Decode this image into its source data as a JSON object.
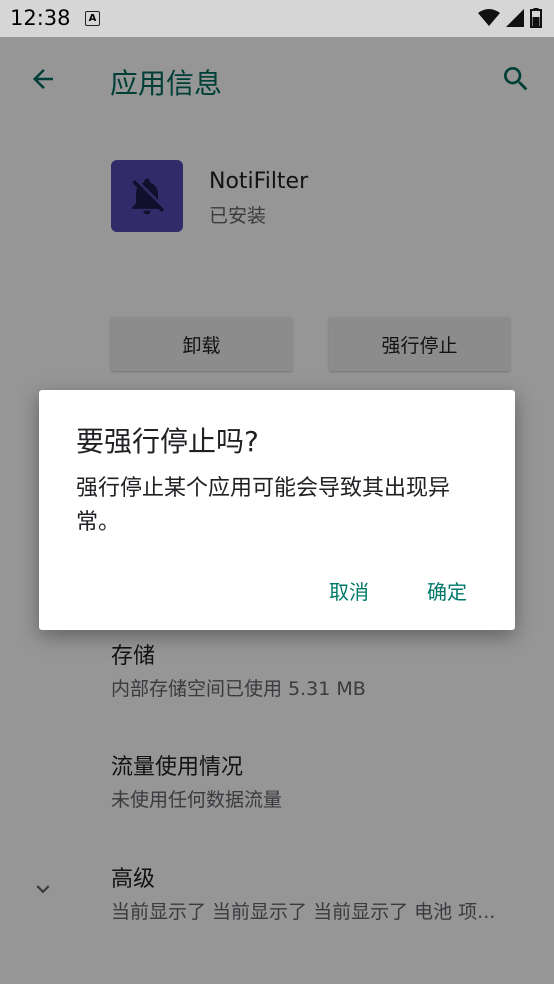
{
  "status_bar": {
    "time": "12:38",
    "notification_icon": "A"
  },
  "app_bar": {
    "title": "应用信息"
  },
  "app": {
    "name": "NotiFilter",
    "status": "已安装"
  },
  "actions": {
    "uninstall": "卸载",
    "force_stop": "强行停止"
  },
  "prefs": {
    "storage": {
      "title": "存储",
      "summary": "内部存储空间已使用 5.31 MB"
    },
    "data_usage": {
      "title": "流量使用情况",
      "summary": "未使用任何数据流量"
    },
    "advanced": {
      "title": "高级",
      "summary": "当前显示了 当前显示了 当前显示了 电池 项..."
    }
  },
  "dialog": {
    "title": "要强行停止吗?",
    "message": "强行停止某个应用可能会导致其出现异常。",
    "cancel": "取消",
    "ok": "确定"
  },
  "colors": {
    "accent": "#00796b",
    "app_icon_bg": "#5448b0"
  }
}
